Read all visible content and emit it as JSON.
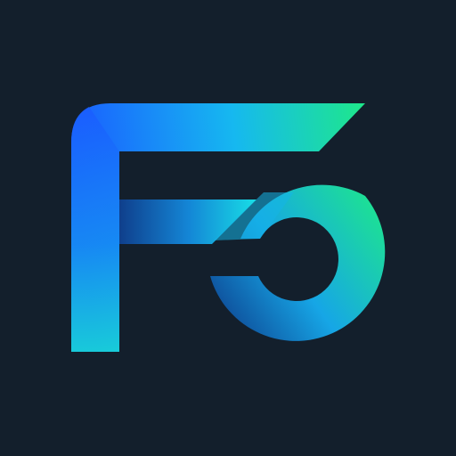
{
  "background_color": "#131f2c",
  "logo": {
    "icon": "f5-monogram-logo-icon",
    "colors": {
      "blue": "#1a5cff",
      "cyan": "#16c8e6",
      "aqua": "#18e0d2",
      "green": "#1ee88a",
      "deep_blue": "#0d3e8c"
    }
  }
}
